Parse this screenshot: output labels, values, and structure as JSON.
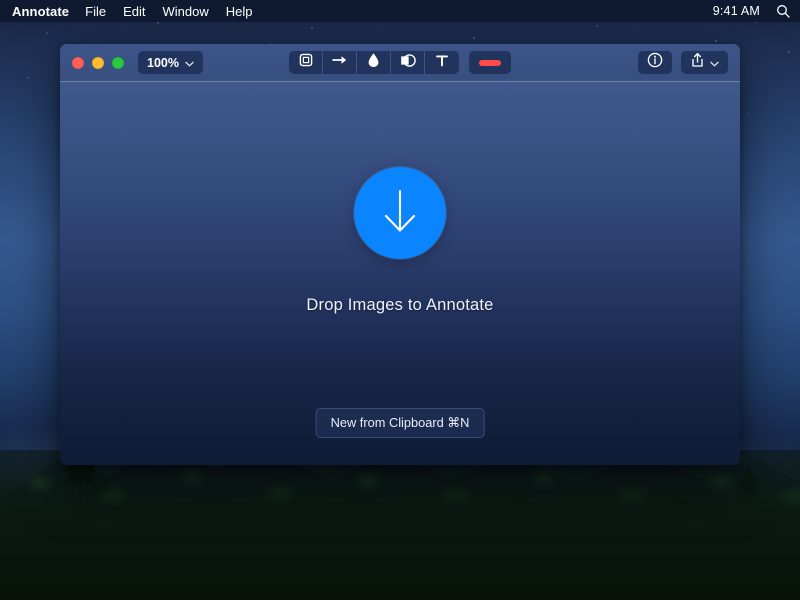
{
  "menubar": {
    "app_title": "Annotate",
    "items": [
      {
        "label": "File"
      },
      {
        "label": "Edit"
      },
      {
        "label": "Window"
      },
      {
        "label": "Help"
      }
    ],
    "clock": "9:41 AM",
    "search_icon": "search-icon"
  },
  "window": {
    "traffic_lights": {
      "close": "close-window-button",
      "minimize": "minimize-window-button",
      "zoom": "maximize-window-button"
    },
    "zoom_control": {
      "value": "100%",
      "chevron_icon": "chevron-down-icon"
    },
    "tools": [
      {
        "name": "crop-tool",
        "icon": "crop-icon"
      },
      {
        "name": "arrow-tool",
        "icon": "arrow-right-icon"
      },
      {
        "name": "blur-tool",
        "icon": "droplet-icon"
      },
      {
        "name": "highlight-tool",
        "icon": "mask-contrast-icon"
      },
      {
        "name": "text-tool",
        "icon": "text-t-icon",
        "label": "T"
      }
    ],
    "stroke_swatch": {
      "name": "stroke-color-swatch",
      "color": "#ff4a4a"
    },
    "info_button": {
      "icon": "info-circle-icon"
    },
    "share_button": {
      "icon": "share-icon",
      "chevron_icon": "chevron-down-icon"
    },
    "canvas": {
      "drop_icon": "download-arrow-icon",
      "drop_circle_color": "#0a84ff",
      "drop_label": "Drop Images to Annotate",
      "clipboard_button": "New from Clipboard ⌘N"
    }
  }
}
